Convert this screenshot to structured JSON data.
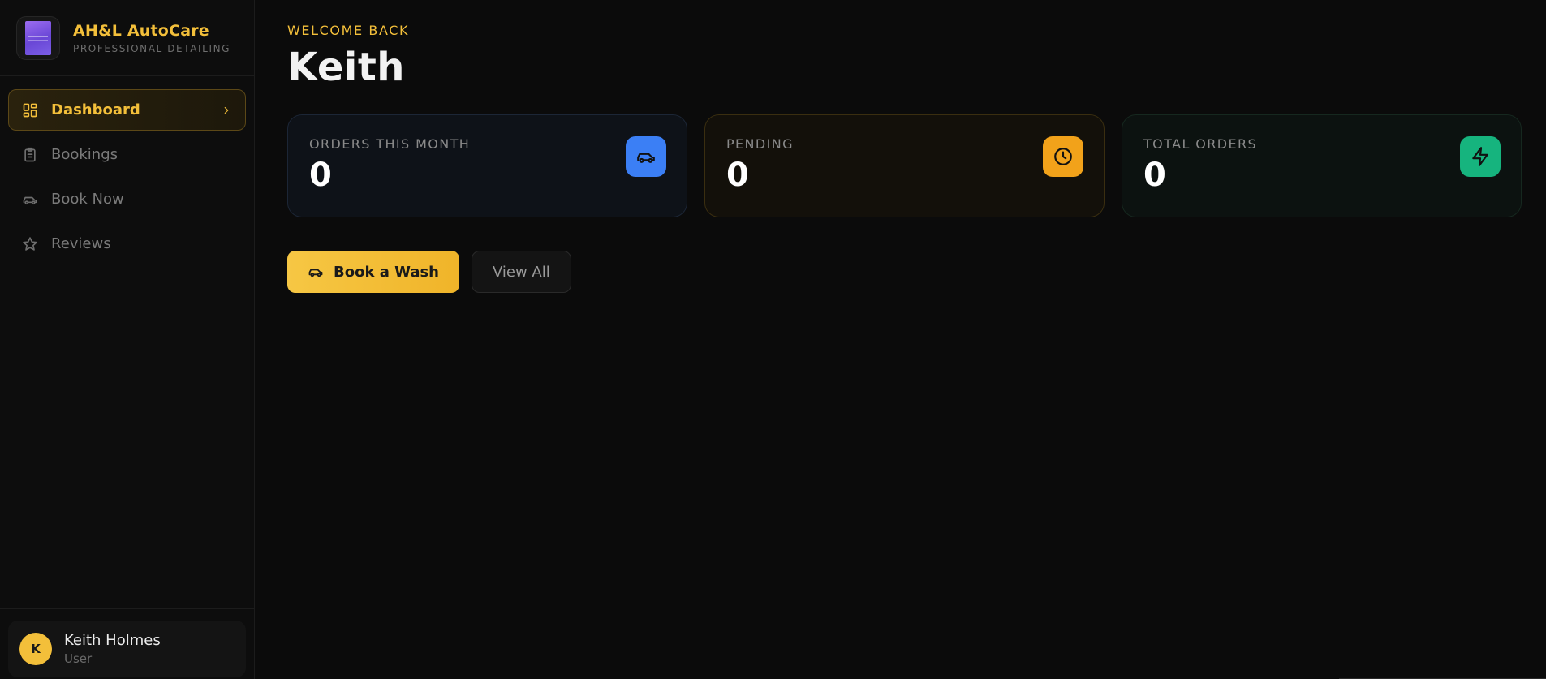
{
  "brand": {
    "title": "AH&L AutoCare",
    "subtitle": "PROFESSIONAL DETAILING"
  },
  "sidebar": {
    "items": [
      {
        "label": "Dashboard",
        "icon": "dashboard-grid-icon",
        "active": true
      },
      {
        "label": "Bookings",
        "icon": "clipboard-icon"
      },
      {
        "label": "Book Now",
        "icon": "car-icon"
      },
      {
        "label": "Reviews",
        "icon": "star-icon"
      }
    ]
  },
  "user": {
    "initial": "K",
    "name": "Keith Holmes",
    "role": "User"
  },
  "main": {
    "welcome": "WELCOME BACK",
    "title": "Keith",
    "stats": [
      {
        "label": "ORDERS THIS MONTH",
        "value": "0",
        "icon": "car-icon",
        "color": "#3b7ff5"
      },
      {
        "label": "PENDING",
        "value": "0",
        "icon": "clock-icon",
        "color": "#f2a21a"
      },
      {
        "label": "TOTAL ORDERS",
        "value": "0",
        "icon": "lightning-icon",
        "color": "#16b47e"
      }
    ],
    "actions": {
      "primary_label": "Book a Wash",
      "secondary_label": "View All"
    }
  },
  "colors": {
    "accent": "#f3bf3a",
    "background": "#0b0b0b"
  }
}
